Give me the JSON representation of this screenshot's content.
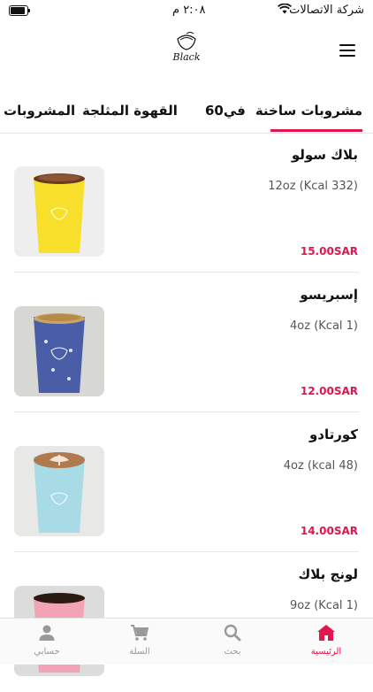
{
  "status_bar": {
    "carrier": "شركة الاتصالات",
    "time": "٢:٠٨ م"
  },
  "header": {
    "logo_text": "Black",
    "logo_icon": "cup-logo-icon",
    "menu_icon": "hamburger-menu-icon"
  },
  "tabs": [
    {
      "label": "مشروبات ساخنة",
      "active": true
    },
    {
      "label": "في60",
      "active": false
    },
    {
      "label": "القهوة المثلجة",
      "active": false
    },
    {
      "label": "المشروبات",
      "active": false
    }
  ],
  "accent_color": "#e2154d",
  "products": [
    {
      "name": "بلاك سولو",
      "desc": "12oz (Kcal 332)",
      "price": "15.00SAR",
      "cup_color": "#f7df2c",
      "image": "iced-cocoa-cup"
    },
    {
      "name": "إسبريسو",
      "desc": "4oz (Kcal 1)",
      "price": "12.00SAR",
      "cup_color": "#4a5ea8",
      "image": "espresso-cup"
    },
    {
      "name": "كورتادو",
      "desc": "4oz (kcal 48)",
      "price": "14.00SAR",
      "cup_color": "#a9dbe6",
      "image": "latte-art-cup"
    },
    {
      "name": "لونج بلاك",
      "desc": "9oz (Kcal 1)",
      "price": "",
      "cup_color": "#f2a3b5",
      "image": "long-black-cup"
    }
  ],
  "bottom_nav": [
    {
      "label": "الرئيسية",
      "icon": "home-icon",
      "active": true
    },
    {
      "label": "بحث",
      "icon": "search-icon",
      "active": false
    },
    {
      "label": "السلة",
      "icon": "cart-icon",
      "active": false
    },
    {
      "label": "حسابي",
      "icon": "account-icon",
      "active": false
    }
  ]
}
